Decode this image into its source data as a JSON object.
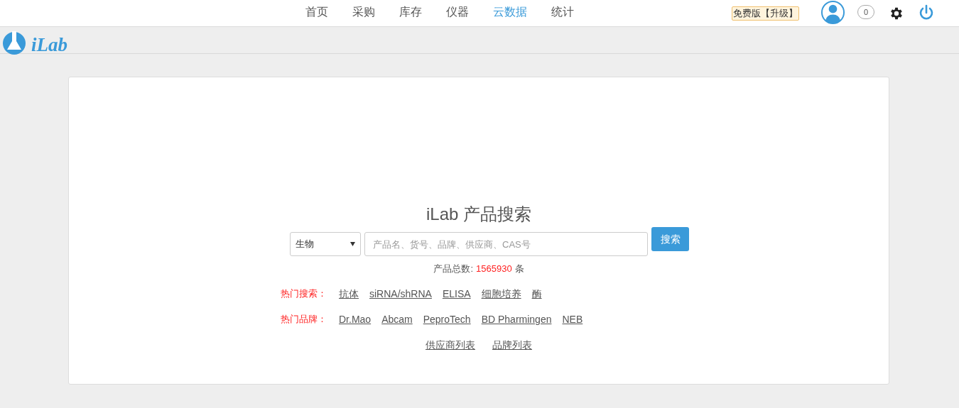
{
  "logo": {
    "text": "iLab"
  },
  "nav": [
    {
      "label": "首页",
      "selected": false
    },
    {
      "label": "采购",
      "selected": false
    },
    {
      "label": "库存",
      "selected": false
    },
    {
      "label": "仪器",
      "selected": false
    },
    {
      "label": "云数据",
      "selected": true
    },
    {
      "label": "统计",
      "selected": false
    }
  ],
  "upgrade": "免费版【升级】",
  "messages": {
    "count": "0"
  },
  "search": {
    "title": "iLab 产品搜索",
    "category": "生物",
    "placeholder": "产品名、货号、品牌、供应商、CAS号",
    "button": "搜索",
    "total_label": "产品总数:",
    "total": "1565930",
    "total_unit": "条"
  },
  "hot_rows": [
    {
      "label": "热门搜索：",
      "links": [
        "抗体",
        "siRNA/shRNA",
        "ELISA",
        "细胞培养",
        "酶"
      ]
    },
    {
      "label": "热门品牌：",
      "links": [
        "Dr.Mao",
        "Abcam",
        "PeproTech",
        "BD Pharmingen",
        "NEB"
      ]
    }
  ],
  "footer_links": [
    "供应商列表",
    "品牌列表"
  ]
}
